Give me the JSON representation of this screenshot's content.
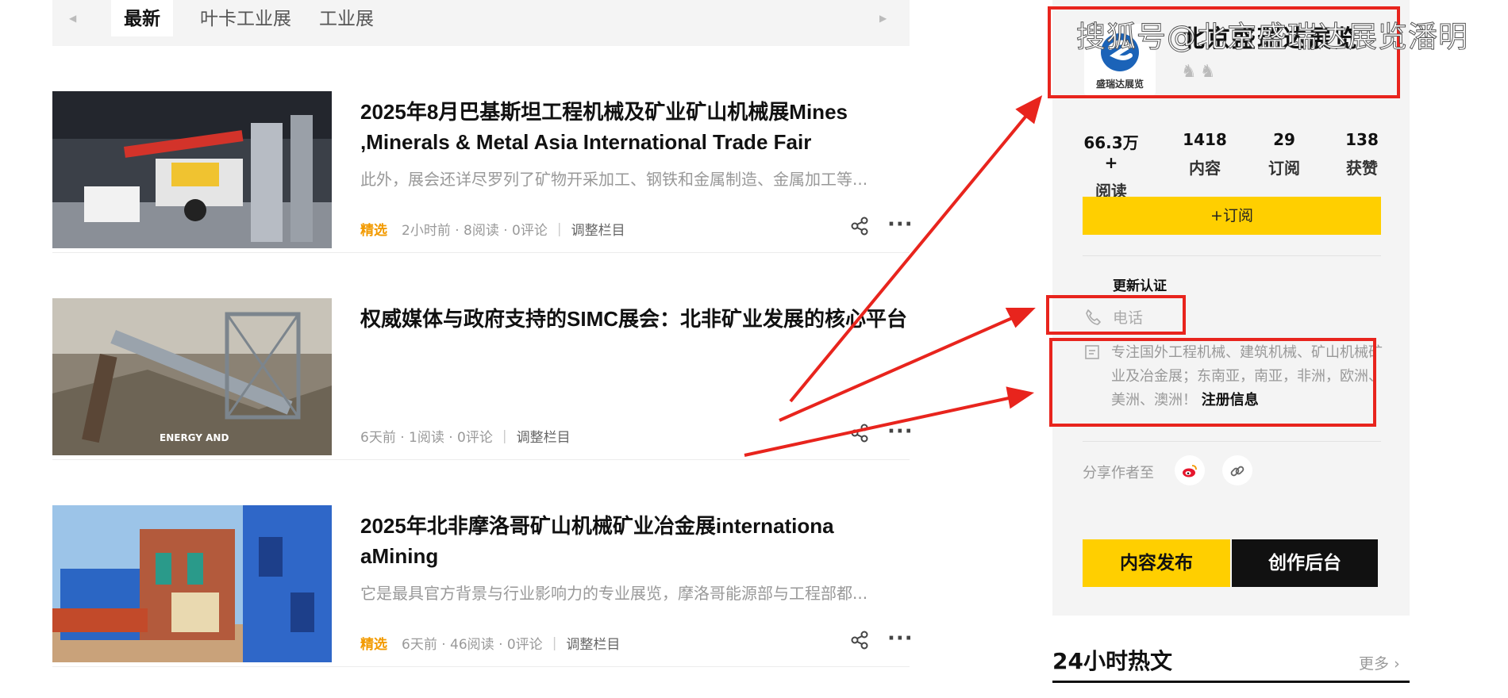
{
  "tabs": [
    {
      "label": "最新",
      "active": true
    },
    {
      "label": "叶卡工业展",
      "active": false
    },
    {
      "label": "工业展",
      "active": false
    }
  ],
  "articles": [
    {
      "title": "2025年8月巴基斯坦工程机械及矿业矿山机械展Mines ,Minerals & Metal Asia International Trade Fair",
      "description": "此外，展会还详尽罗列了矿物开采加工、钢铁和金属制造、金属加工等...",
      "tag": "精选",
      "meta": "2小时前 · 8阅读 · 0评论",
      "adjust": "调整栏目"
    },
    {
      "title": "权威媒体与政府支持的SIMC展会：北非矿业发展的核心平台",
      "description": "",
      "tag": "",
      "meta": "6天前 · 1阅读 · 0评论",
      "adjust": "调整栏目",
      "thumb_caption": "ENERGY AND"
    },
    {
      "title": "2025年北非摩洛哥矿山机械矿业冶金展internationa aMining",
      "description": "它是最具官方背景与行业影响力的专业展览，摩洛哥能源部与工程部都...",
      "tag": "精选",
      "meta": "6天前 · 46阅读 · 0评论",
      "adjust": "调整栏目"
    }
  ],
  "author": {
    "name": "北京盛瑞达展览",
    "logo_caption": "盛瑞达展览",
    "stats": [
      {
        "value": "66.3万+",
        "label": "阅读"
      },
      {
        "value": "1418",
        "label": "内容"
      },
      {
        "value": "29",
        "label": "订阅"
      },
      {
        "value": "138",
        "label": "获赞"
      }
    ],
    "subscribe_label": "+订阅",
    "verify_title": "更新认证",
    "phone_label": "电话",
    "description": "专注国外工程机械、建筑机械、矿山机械矿业及冶金展；东南亚，南亚，非洲，欧洲、美洲、澳洲！",
    "register_link": "注册信息",
    "share_label": "分享作者至",
    "publish_label": "内容发布",
    "studio_label": "创作后台"
  },
  "hot": {
    "title": "24小时热文",
    "more": "更多"
  },
  "watermark": "搜狐号@北京盛瑞达展览潘明",
  "colors": {
    "accent_yellow": "#ffcf00",
    "tag_orange": "#f29a00",
    "annotation_red": "#e8241d",
    "sidebar_bg": "#f4f4f4"
  }
}
